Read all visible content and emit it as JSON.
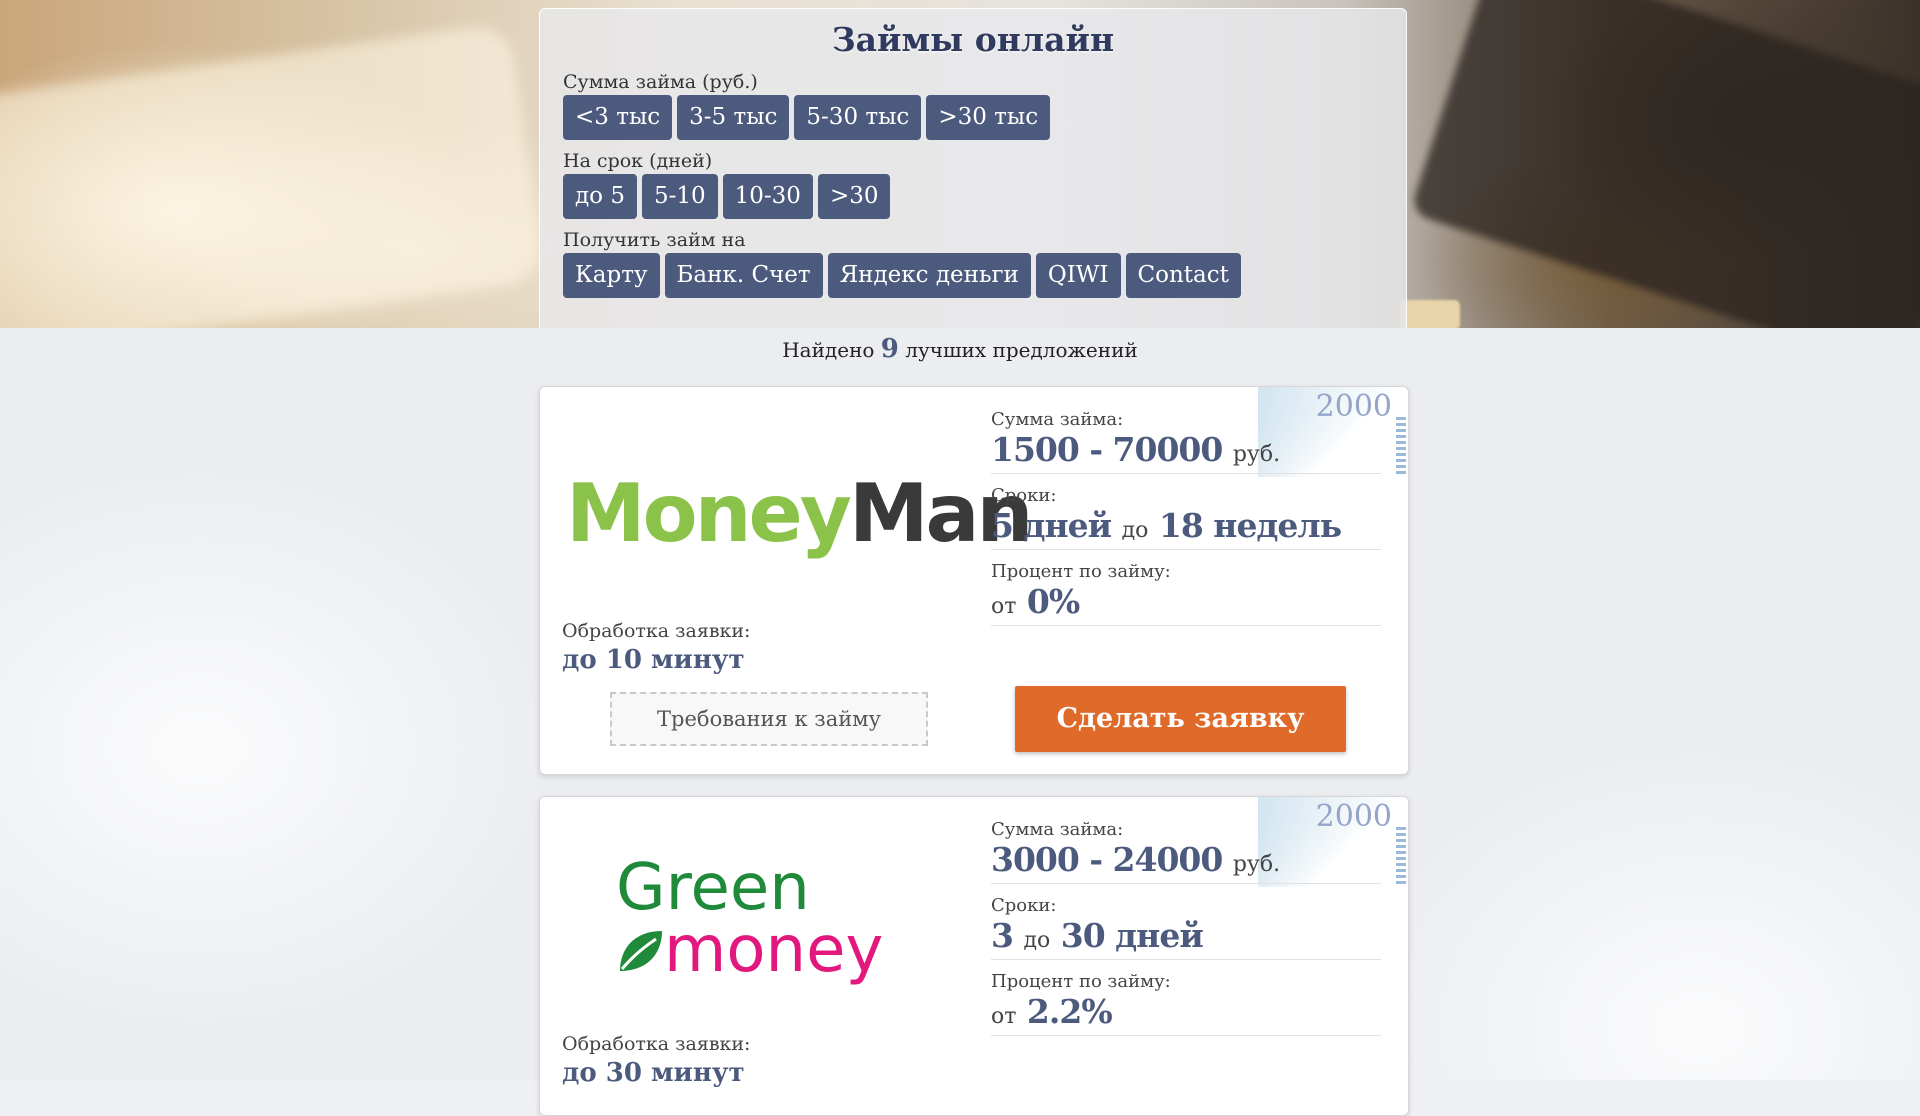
{
  "filters": {
    "title": "Займы онлайн",
    "amount": {
      "label": "Сумма займа (руб.)",
      "options": [
        "<3 тыс",
        "3-5 тыс",
        "5-30 тыс",
        ">30 тыс"
      ]
    },
    "term": {
      "label": "На срок (дней)",
      "options": [
        "до 5",
        "5-10",
        "10-30",
        ">30"
      ]
    },
    "method": {
      "label": "Получить займ на",
      "options": [
        "Карту",
        "Банк. Счет",
        "Яндекс деньги",
        "QIWI",
        "Contact"
      ]
    }
  },
  "results": {
    "prefix": "Найдено",
    "count": "9",
    "suffix": "лучших предложений"
  },
  "offers": [
    {
      "banknote": "2000",
      "logo": {
        "part1": "Money",
        "part2": "Man",
        "colors": {
          "part1": "#8bc24a",
          "part2": "#3a3a3a"
        }
      },
      "amount": {
        "label": "Сумма займа:",
        "value": "1500 - 70000",
        "unit": "руб."
      },
      "term": {
        "label": "Сроки:",
        "from": "5 дней",
        "sep": "до",
        "to": "18 недель"
      },
      "rate": {
        "label": "Процент по займу:",
        "prefix": "от",
        "value": "0%"
      },
      "processing": {
        "label": "Обработка заявки:",
        "value": "до 10 минут"
      },
      "requirements_label": "Требования к займу",
      "apply_label": "Сделать заявку"
    },
    {
      "banknote": "2000",
      "logo": {
        "part1": "Green",
        "part2": "money",
        "icon": "leaf-icon",
        "colors": {
          "part1": "#1f8a3a",
          "part2": "#e2187f"
        }
      },
      "amount": {
        "label": "Сумма займа:",
        "value": "3000 - 24000",
        "unit": "руб."
      },
      "term": {
        "label": "Сроки:",
        "from": "3",
        "sep": "до",
        "to": "30 дней"
      },
      "rate": {
        "label": "Процент по займу:",
        "prefix": "от",
        "value": "2.2%"
      },
      "processing": {
        "label": "Обработка заявки:",
        "value": "до 30 минут"
      }
    }
  ],
  "colors": {
    "accent": "#4c5a7e",
    "apply": "#e06a29"
  }
}
